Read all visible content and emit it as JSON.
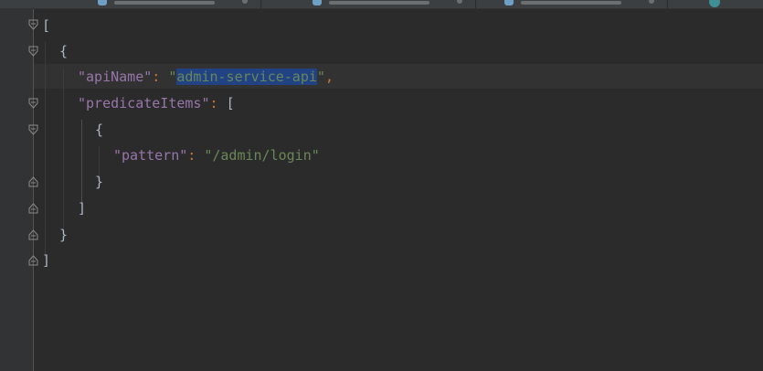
{
  "editor": {
    "colors": {
      "background": "#2b2b2b",
      "gutter": "#313335",
      "key": "#9876aa",
      "string": "#6a8759",
      "punctuation": "#cc7832",
      "default": "#a9b7c6",
      "selection": "#214283"
    },
    "tabs": [
      {
        "icon": "json-file-icon"
      },
      {
        "icon": "json-file-icon"
      },
      {
        "icon": "json-file-icon"
      }
    ],
    "code": {
      "open_bracket": "[",
      "open_brace": "{",
      "key_apiName": "\"apiName\"",
      "colon": ":",
      "quote": "\"",
      "value_apiName": "admin-service-api",
      "comma": ",",
      "key_predicateItems": "\"predicateItems\"",
      "key_pattern": "\"pattern\"",
      "value_pattern": "\"/admin/login\"",
      "close_brace": "}",
      "close_bracket": "]"
    }
  }
}
